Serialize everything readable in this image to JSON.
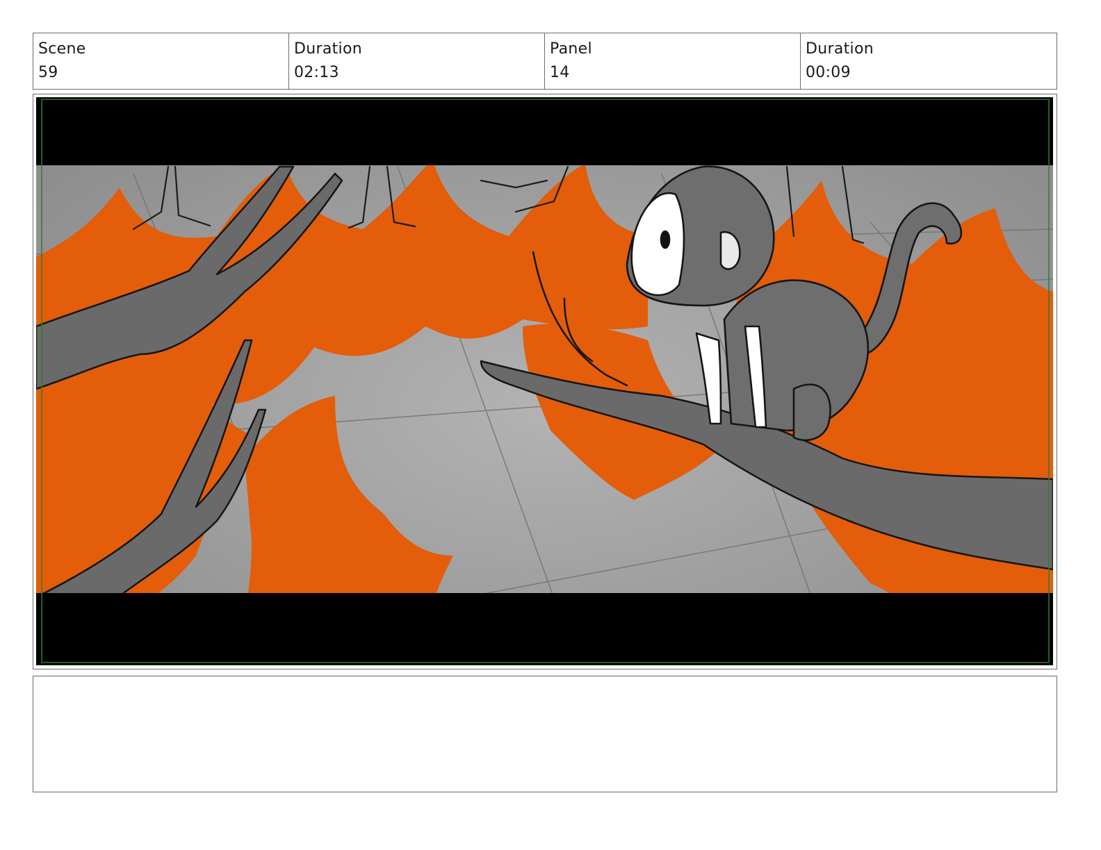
{
  "header": {
    "scene": {
      "label": "Scene",
      "value": "59"
    },
    "scene_duration": {
      "label": "Duration",
      "value": "02:13"
    },
    "panel": {
      "label": "Panel",
      "value": "14"
    },
    "panel_duration": {
      "label": "Duration",
      "value": "00:09"
    }
  },
  "panel_drawing": {
    "subject": "monkey-on-branch-sketch",
    "colors": {
      "letterbox": "#000000",
      "ground": "#a3a3a3",
      "shadow_orange": "#e35d0a",
      "branch_gray": "#6a6a6a",
      "monkey_gray": "#6e6e6e",
      "safe_frame": "#2f7d2f"
    }
  },
  "notes": {
    "text": ""
  }
}
